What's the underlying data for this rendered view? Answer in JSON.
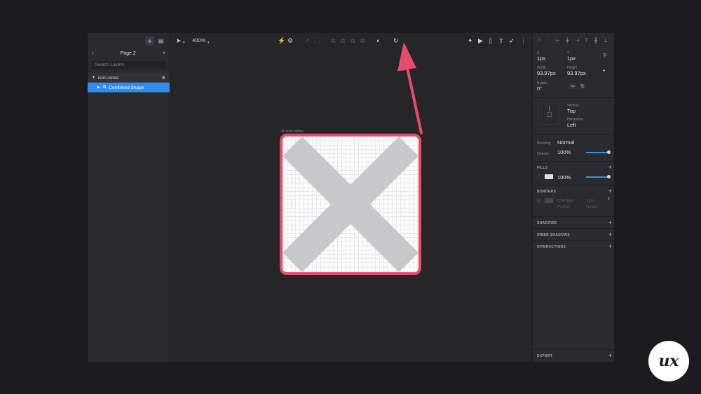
{
  "left_panel": {
    "page_name": "Page 2",
    "search_placeholder": "Search Layers",
    "layers": [
      {
        "name": "icon-close"
      },
      {
        "name": "Combined Shape"
      }
    ]
  },
  "toolbar": {
    "zoom": "400%"
  },
  "artboard": {
    "label": "icon-close"
  },
  "inspector": {
    "x_label": "X",
    "x_value": "1px",
    "y_label": "Y",
    "y_value": "1px",
    "width_label": "Width",
    "width_value": "93.97px",
    "height_label": "Height",
    "height_value": "93.97px",
    "rotate_label": "Rotate",
    "rotate_value": "0°",
    "vertical_label": "Vertical",
    "vertical_value": "Top",
    "horizontal_label": "Horizontal",
    "horizontal_value": "Left",
    "blending_label": "Blending",
    "blending_value": "Normal",
    "opacity_label": "Opacity",
    "opacity_value": "100%",
    "fills_header": "FILLS",
    "fill_opacity": "100%",
    "borders_header": "BORDERS",
    "border_position_value": "Center",
    "border_position_label": "Position",
    "border_weight_value": "1px",
    "border_weight_label": "Weight",
    "shadows_header": "SHADOWS",
    "inner_shadows_header": "INNER SHADOWS",
    "interactions_header": "INTERACTIONS",
    "export_header": "EXPORT"
  },
  "colors": {
    "accent": "#2f8df0",
    "highlight": "#e64b6e",
    "shape": "#c8c8ca"
  },
  "brand": {
    "logo_text": "ux"
  }
}
